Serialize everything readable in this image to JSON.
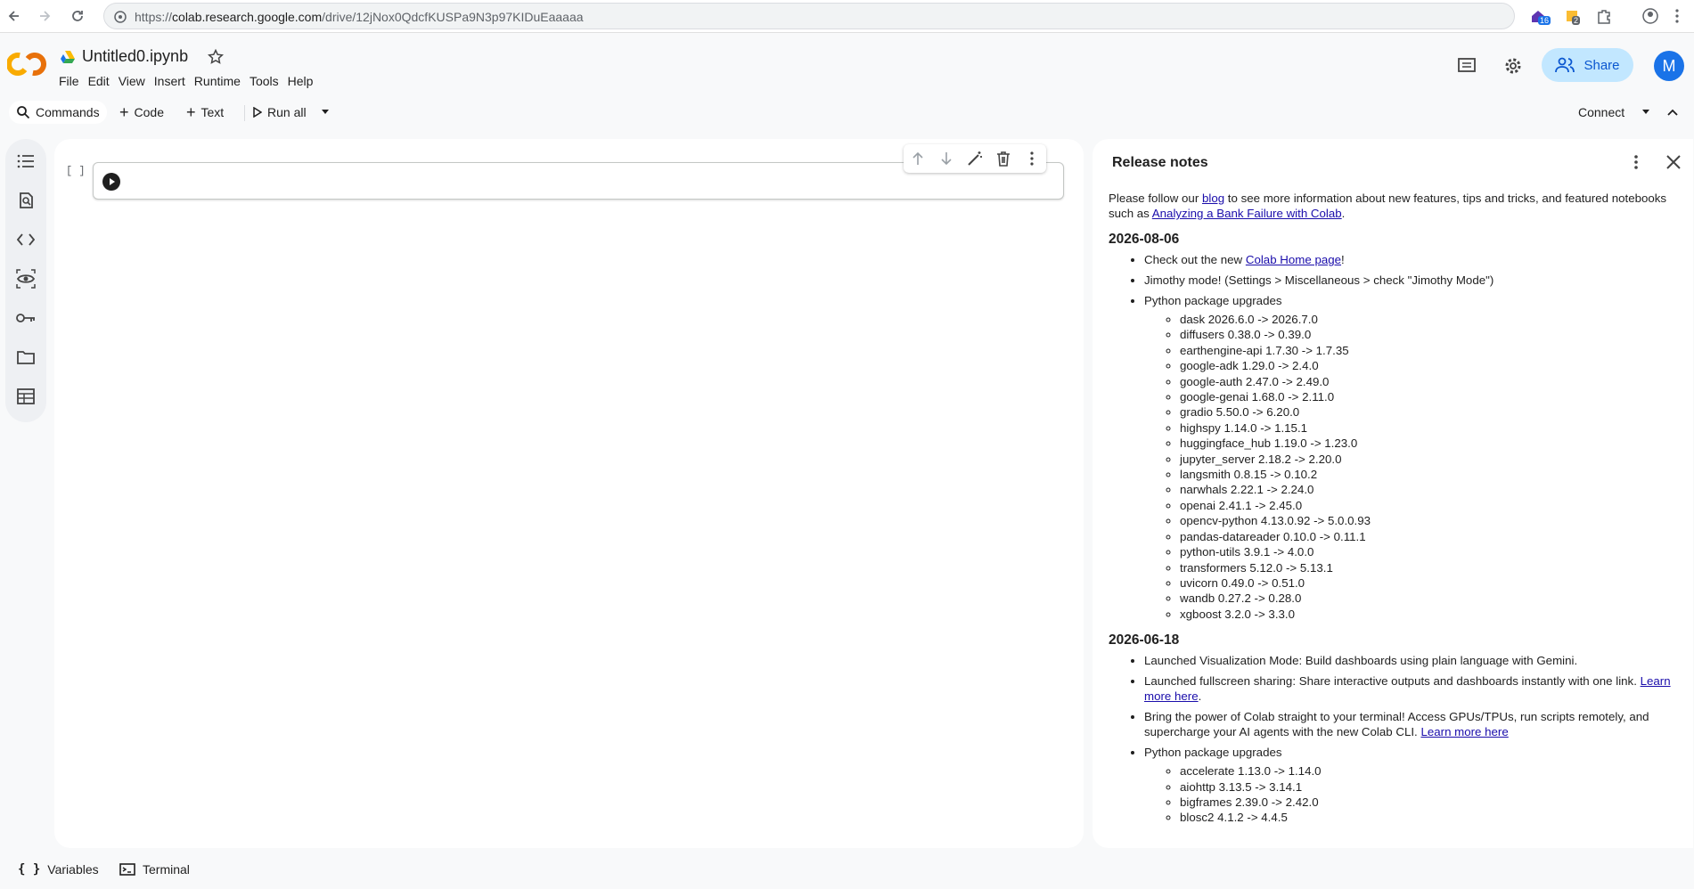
{
  "browser": {
    "url_prefix": "https://",
    "url_host": "colab.research.google.com",
    "url_path": "/drive/12jNox0QdcfKUSPa9N3p97KIDuEaaaaa",
    "ext_badge_1": "16",
    "ext_badge_2": "2"
  },
  "header": {
    "logo": "CO",
    "title": "Untitled0.ipynb",
    "menu": [
      "File",
      "Edit",
      "View",
      "Insert",
      "Runtime",
      "Tools",
      "Help"
    ],
    "share_label": "Share",
    "avatar_initial": "M"
  },
  "toolbar": {
    "commands": "Commands",
    "code": "Code",
    "text": "Text",
    "run_all": "Run all",
    "connect": "Connect"
  },
  "cell": {
    "bracket": "[ ]"
  },
  "release_notes": {
    "title": "Release notes",
    "intro_a": "Please follow our ",
    "intro_link1": "blog",
    "intro_b": " to see more information about new features, tips and tricks, and featured notebooks such as ",
    "intro_link2": "Analyzing a Bank Failure with Colab",
    "intro_c": ".",
    "s1": {
      "date": "2026-08-06",
      "b1_a": "Check out the new ",
      "b1_link": "Colab Home page",
      "b1_b": "!",
      "b2": "Jimothy mode! (Settings > Miscellaneous > check \"Jimothy Mode\")",
      "b3": "Python package upgrades",
      "packages": [
        "dask 2026.6.0 -> 2026.7.0",
        "diffusers 0.38.0 -> 0.39.0",
        "earthengine-api 1.7.30 -> 1.7.35",
        "google-adk 1.29.0 -> 2.4.0",
        "google-auth 2.47.0 -> 2.49.0",
        "google-genai 1.68.0 -> 2.11.0",
        "gradio 5.50.0 -> 6.20.0",
        "highspy 1.14.0 -> 1.15.1",
        "huggingface_hub 1.19.0 -> 1.23.0",
        "jupyter_server 2.18.2 -> 2.20.0",
        "langsmith 0.8.15 -> 0.10.2",
        "narwhals 2.22.1 -> 2.24.0",
        "openai 2.41.1 -> 2.45.0",
        "opencv-python 4.13.0.92 -> 5.0.0.93",
        "pandas-datareader 0.10.0 -> 0.11.1",
        "python-utils 3.9.1 -> 4.0.0",
        "transformers 5.12.0 -> 5.13.1",
        "uvicorn 0.49.0 -> 0.51.0",
        "wandb 0.27.2 -> 0.28.0",
        "xgboost 3.2.0 -> 3.3.0"
      ]
    },
    "s2": {
      "date": "2026-06-18",
      "b1": "Launched Visualization Mode: Build dashboards using plain language with Gemini.",
      "b2_a": "Launched fullscreen sharing: Share interactive outputs and dashboards instantly with one link. ",
      "b2_link": "Learn more here",
      "b2_b": ".",
      "b3_a": "Bring the power of Colab straight to your terminal! Access GPUs/TPUs, run scripts remotely, and supercharge your AI agents with the new Colab CLI. ",
      "b3_link": "Learn more here",
      "b4": "Python package upgrades",
      "packages": [
        "accelerate 1.13.0 -> 1.14.0",
        "aiohttp 3.13.5 -> 3.14.1",
        "bigframes 2.39.0 -> 2.42.0",
        "blosc2 4.1.2 -> 4.4.5"
      ]
    }
  },
  "bottom": {
    "variables": "Variables",
    "terminal": "Terminal"
  }
}
